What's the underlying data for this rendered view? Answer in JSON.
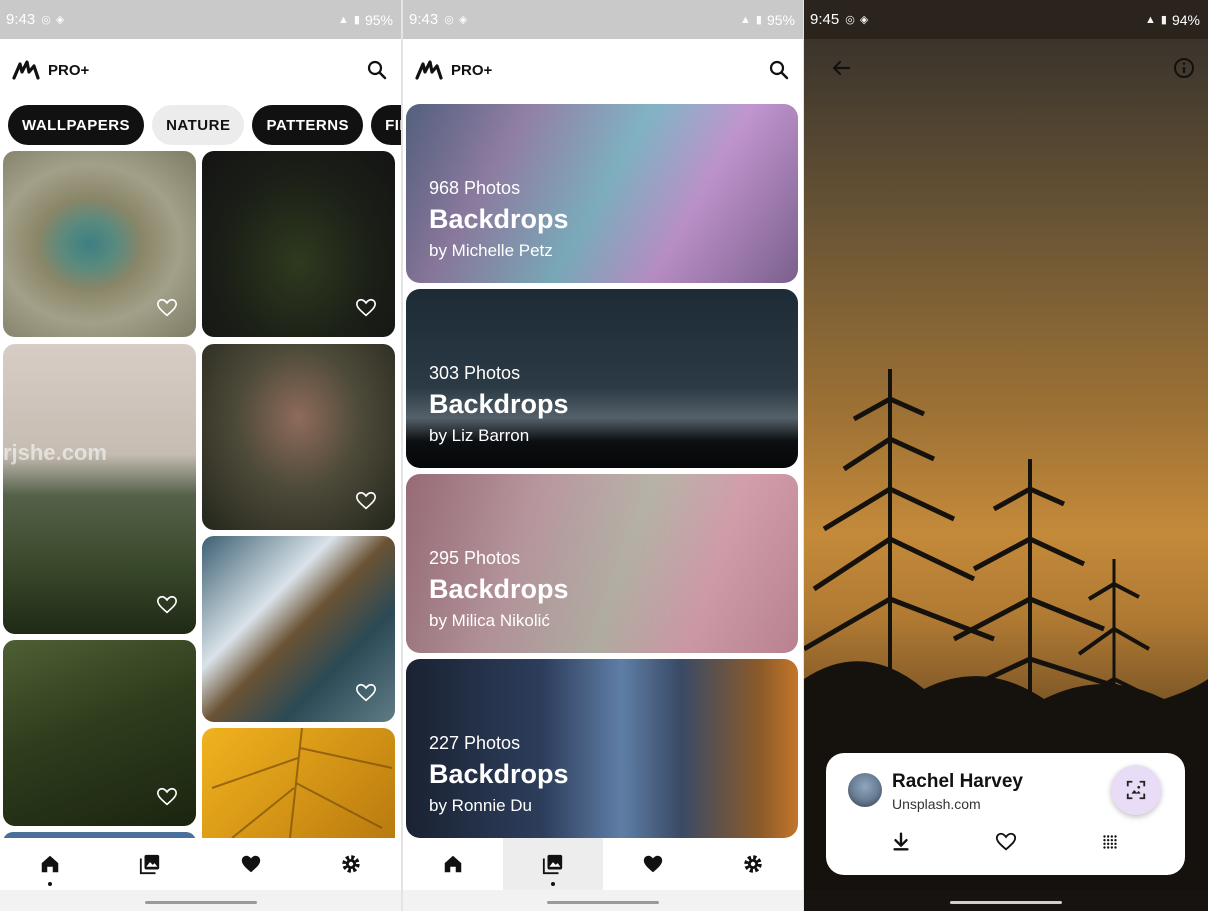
{
  "panels": {
    "home": {
      "status": {
        "time": "9:43",
        "battery": "95%"
      },
      "brand": "PRO+",
      "chips": [
        "WALLPAPERS",
        "NATURE",
        "PATTERNS",
        "FILM"
      ],
      "watermark": "rjshe.com",
      "nav": [
        "home",
        "collections",
        "favorites",
        "settings"
      ],
      "active_nav": "home"
    },
    "collections": {
      "status": {
        "time": "9:43",
        "battery": "95%"
      },
      "brand": "PRO+",
      "cards": [
        {
          "count": "968 Photos",
          "name": "Backdrops",
          "by": "by Michelle Petz"
        },
        {
          "count": "303 Photos",
          "name": "Backdrops",
          "by": "by Liz Barron"
        },
        {
          "count": "295 Photos",
          "name": "Backdrops",
          "by": "by Milica Nikolić"
        },
        {
          "count": "227 Photos",
          "name": "Backdrops",
          "by": "by Ronnie Du"
        }
      ],
      "active_nav": "collections"
    },
    "detail": {
      "status": {
        "time": "9:45",
        "battery": "94%"
      },
      "author": "Rachel Harvey",
      "source": "Unsplash.com"
    }
  },
  "icons": {
    "search": "search-icon",
    "heart": "heart-outline-icon",
    "home": "home-icon",
    "collections": "collections-icon",
    "favorites": "heart-filled-icon",
    "settings": "gear-icon",
    "back": "arrow-back-icon",
    "info": "info-icon",
    "download": "download-icon",
    "set_wallpaper": "wallpaper-icon",
    "palette": "dots-grid-icon"
  },
  "colors": {
    "accent": "#e8dcf7",
    "chip_dark": "#111111",
    "chip_light": "#ececec"
  }
}
